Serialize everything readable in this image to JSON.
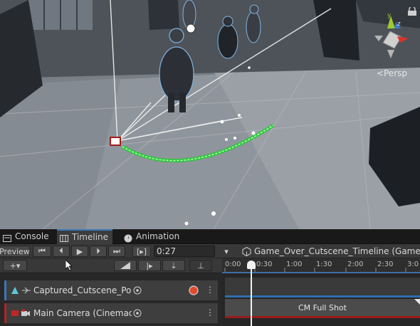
{
  "scene": {
    "view_mode_label": "Persp",
    "gizmo_axes": {
      "y": "y",
      "z": "z"
    },
    "colors": {
      "path": "#22cc33",
      "gizmo_y": "#9ecb2d",
      "gizmo_x": "#d8342c",
      "gizmo_z": "#3a7bd5"
    }
  },
  "tabs": [
    {
      "label": "Console",
      "icon": "console-icon"
    },
    {
      "label": "Timeline",
      "icon": "timeline-icon",
      "active": true
    },
    {
      "label": "Animation",
      "icon": "animation-icon"
    }
  ],
  "toolbar": {
    "preview_label": "Preview",
    "frame_label": "[▸]",
    "current_time": "0:27",
    "asset_title": "Game_Over_Cutscene_Timeline (Game_Ov"
  },
  "ruler": {
    "ticks": [
      "0:00",
      "0:30",
      "1:00",
      "1:30",
      "2:00",
      "2:30",
      "3:0"
    ]
  },
  "tracks": [
    {
      "name": "Captured_Cutscene_Pos",
      "color": "#3a79bb"
    },
    {
      "name": "Main Camera (Cinemac",
      "color": "#b52222"
    }
  ],
  "clips": {
    "camera_clip_label": "CM Full Shot"
  }
}
